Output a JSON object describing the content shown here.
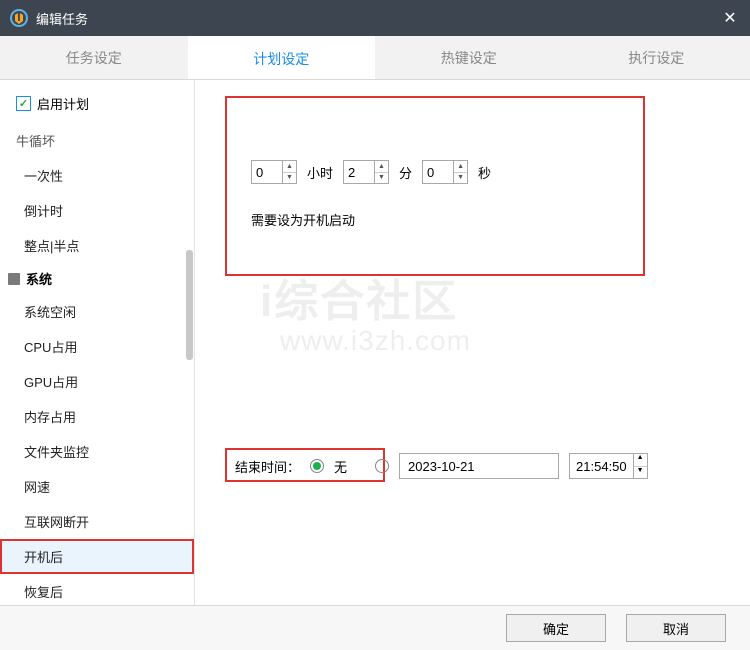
{
  "window": {
    "title": "编辑任务"
  },
  "tabs": {
    "task": "任务设定",
    "plan": "计划设定",
    "hotkey": "热键设定",
    "exec": "执行设定"
  },
  "sidebar": {
    "enable_label": "启用计划",
    "enable_checked": true,
    "cat_partial": "牛循坏",
    "items_top": [
      "一次性",
      "倒计时",
      "整点|半点"
    ],
    "cat_system": "系统",
    "items_sys": [
      "系统空闲",
      "CPU占用",
      "GPU占用",
      "内存占用",
      "文件夹监控",
      "网速",
      "互联网断开",
      "开机后",
      "恢复后"
    ],
    "selected": "开机后"
  },
  "timer": {
    "hours": "0",
    "hours_unit": "小时",
    "minutes": "2",
    "minutes_unit": "分",
    "seconds": "0",
    "seconds_unit": "秒",
    "note": "需要设为开机启动"
  },
  "end": {
    "label": "结束时间：",
    "none_label": "无",
    "none_selected": true,
    "date": "2023-10-21",
    "time": "21:54:50"
  },
  "footer": {
    "ok": "确定",
    "cancel": "取消"
  },
  "watermark": {
    "line1": "i综合社区",
    "line2": "www.i3zh.com"
  }
}
